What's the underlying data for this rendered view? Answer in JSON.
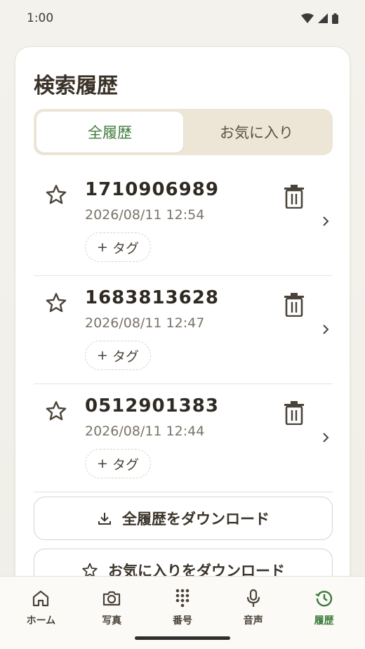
{
  "status_bar": {
    "time": "1:00"
  },
  "card": {
    "title": "検索履歴"
  },
  "tabs": [
    {
      "label": "全履歴",
      "active": true
    },
    {
      "label": "お気に入り",
      "active": false
    }
  ],
  "history": [
    {
      "number": "1710906989",
      "datetime": "2026/08/11 12:54",
      "tag_label": "タグ"
    },
    {
      "number": "1683813628",
      "datetime": "2026/08/11 12:47",
      "tag_label": "タグ"
    },
    {
      "number": "0512901383",
      "datetime": "2026/08/11 12:44",
      "tag_label": "タグ"
    }
  ],
  "buttons": {
    "download_all": "全履歴をダウンロード",
    "download_favorites": "お気に入りをダウンロード"
  },
  "nav": [
    {
      "label": "ホーム",
      "icon": "home-icon",
      "active": false
    },
    {
      "label": "写真",
      "icon": "camera-icon",
      "active": false
    },
    {
      "label": "番号",
      "icon": "dialpad-icon",
      "active": false
    },
    {
      "label": "音声",
      "icon": "microphone-icon",
      "active": false
    },
    {
      "label": "履歴",
      "icon": "history-icon",
      "active": true
    }
  ],
  "colors": {
    "accent": "#3d7a3b",
    "segment_bg": "#ede6d6",
    "text": "#3a3228"
  }
}
